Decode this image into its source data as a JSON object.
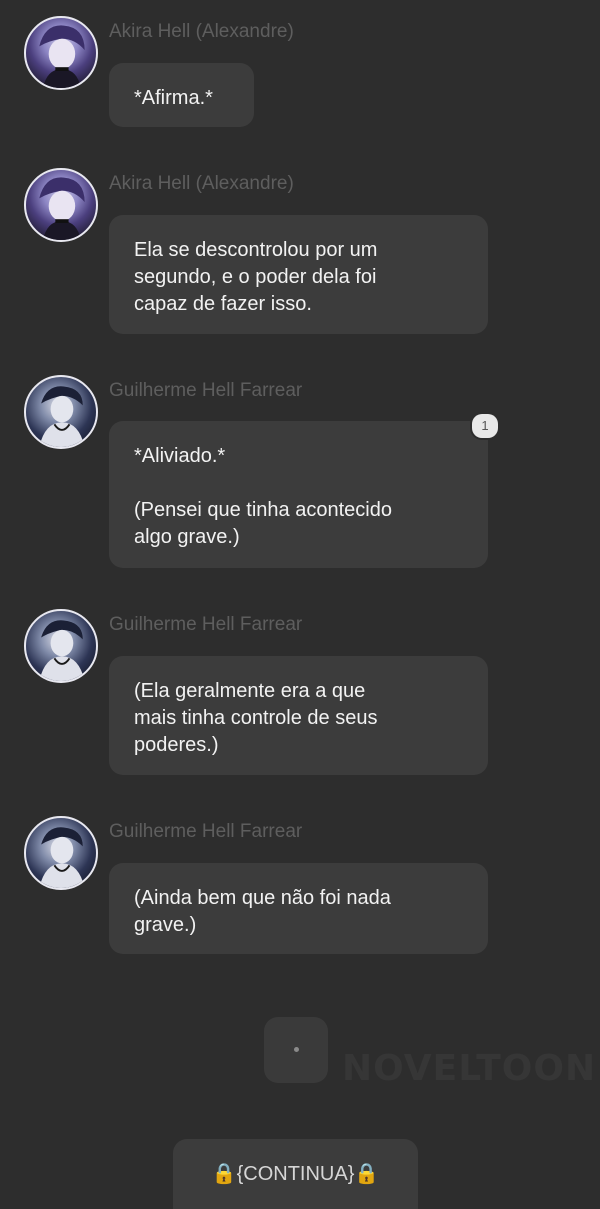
{
  "messages": [
    {
      "author": "Akira Hell (Alexandre)",
      "avatar": "akira-avatar",
      "text": "*Afirma.*"
    },
    {
      "author": "Akira Hell (Alexandre)",
      "avatar": "akira-avatar",
      "text": "Ela se descontrolou por um\nsegundo, e o poder dela foi\ncapaz de fazer isso."
    },
    {
      "author": "Guilherme Hell Farrear",
      "avatar": "guilherme-avatar",
      "text": "*Aliviado.*\n\n(Pensei que tinha acontecido\nalgo grave.)",
      "badge": "1"
    },
    {
      "author": "Guilherme Hell Farrear",
      "avatar": "guilherme-avatar",
      "text": "(Ela geralmente era a que\nmais tinha controle de seus\npoderes.)"
    },
    {
      "author": "Guilherme Hell Farrear",
      "avatar": "guilherme-avatar",
      "text": "(Ainda bem que não foi nada\ngrave.)"
    }
  ],
  "watermark": {
    "text": "NOVELTOON",
    "dot": "·"
  },
  "continue_button": {
    "label": "🔒{CONTINUA}🔒"
  },
  "colors": {
    "background": "#2d2d2d",
    "bubble": "#3c3c3c",
    "name": "#5e5e5e",
    "text": "#f2f2f2"
  }
}
